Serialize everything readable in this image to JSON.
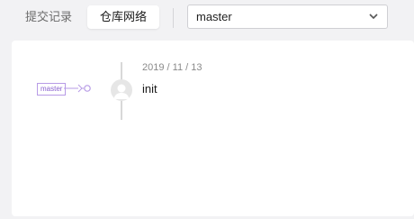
{
  "tabs": [
    {
      "label": "提交记录",
      "active": false
    },
    {
      "label": "仓库网络",
      "active": true
    }
  ],
  "branch_select": {
    "value": "master",
    "icon": "chevron-down-icon"
  },
  "graph": {
    "branch_label": "master",
    "commit": {
      "date": "2019 / 11 / 13",
      "message": "init",
      "avatar_icon": "user-avatar-icon"
    }
  },
  "colors": {
    "accent_branch": "#8a62cf",
    "timeline": "#d8d8d8",
    "background": "#f2f2f4"
  }
}
